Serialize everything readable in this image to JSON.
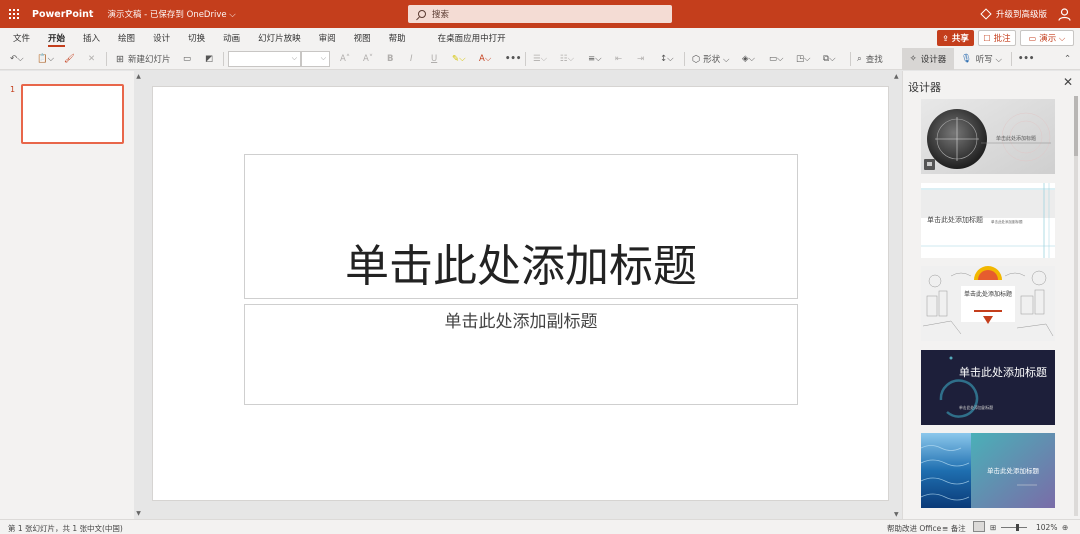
{
  "titlebar": {
    "app_name": "PowerPoint",
    "doc_name": "演示文稿 - 已保存到 OneDrive ⌵",
    "search_placeholder": "搜索",
    "upgrade": "升级到高级版",
    "accent": "#c43e1c"
  },
  "menu": {
    "items": [
      "文件",
      "开始",
      "插入",
      "绘图",
      "设计",
      "切换",
      "动画",
      "幻灯片放映",
      "审阅",
      "视图",
      "帮助"
    ],
    "active": "开始",
    "open_desktop": "在桌面应用中打开",
    "share": "共享",
    "comments": "批注",
    "present": "演示 ⌵"
  },
  "toolbar": {
    "undo": "↶⌵",
    "paste": "📋⌵",
    "format_painter": "🖌",
    "clear": "✕",
    "new_slide": "新建幻灯片",
    "layout_icon": "▭",
    "reset_icon": "◩",
    "grow_font": "A˄",
    "shrink_font": "A˅",
    "bold": "B",
    "italic": "I",
    "underline": "U",
    "highlight": "✎⌵",
    "font_color": "A⌵",
    "more1": "•••",
    "bullets": "☰⌵",
    "numbering": "☷⌵",
    "align": "≡⌵",
    "outdent": "⇤",
    "indent": "⇥",
    "line_spacing": "↕⌵",
    "shapes": "形状 ⌵",
    "fill": "◈⌵",
    "outline": "▭⌵",
    "effects": "◳⌵",
    "arrange": "⧉⌵",
    "find": "查找",
    "designer": "设计器",
    "dictate": "听写 ⌵",
    "more2": "•••",
    "collapse": "⌃"
  },
  "thumbpane": {
    "slide_number": "1"
  },
  "slide": {
    "title_placeholder": "单击此处添加标题",
    "subtitle_placeholder": "单击此处添加副标题"
  },
  "designer": {
    "title": "设计器",
    "close": "✕",
    "cards": [
      {
        "name": "compass-design",
        "title": "单击此处添加标题"
      },
      {
        "name": "lines-design",
        "title": "单击此处添加标题",
        "subtitle": "单击此处添加副标题"
      },
      {
        "name": "sketch-design",
        "title": "单击此处添加标题"
      },
      {
        "name": "dark-navy-design",
        "title": "单击此处添加标题",
        "subtitle": "单击此处添加副标题"
      },
      {
        "name": "water-design",
        "title": "单击此处添加标题"
      }
    ]
  },
  "statusbar": {
    "slide_info": "第 1 张幻灯片，共 1 张",
    "language": "中文(中国)",
    "feedback": "帮助改进 Office",
    "notes": "备注",
    "zoom": "102%"
  }
}
